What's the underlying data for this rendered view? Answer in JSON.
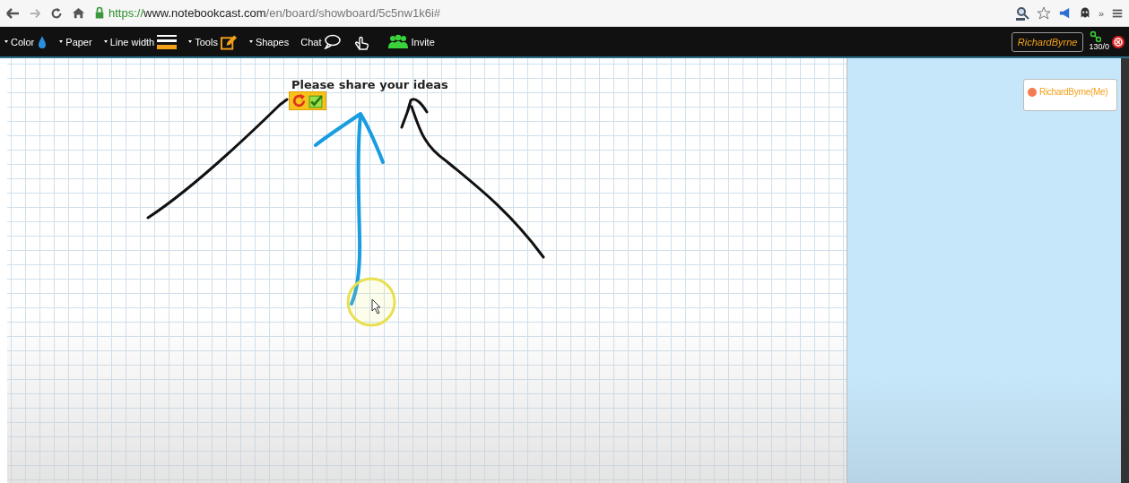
{
  "browser": {
    "url": {
      "scheme": "https://",
      "host": "www.notebookcast.com",
      "path": "/en/board/showboard/5c5nw1k6i#"
    },
    "overflow": "»"
  },
  "toolbar": {
    "items": [
      {
        "kind": "dropdown",
        "label": "Color"
      },
      {
        "kind": "dropdown",
        "label": "Paper"
      },
      {
        "kind": "dropdown",
        "label": "Line width"
      },
      {
        "kind": "dropdown",
        "label": "Tools"
      },
      {
        "kind": "dropdown",
        "label": "Shapes"
      },
      {
        "kind": "button",
        "label": "Chat"
      },
      {
        "kind": "icon"
      },
      {
        "kind": "button",
        "label": "Invite"
      }
    ],
    "user": "RichardByrne",
    "counter": "130/0"
  },
  "board": {
    "title": "Please share your ideas"
  },
  "participants": [
    {
      "name": "RichardByrne(Me)",
      "color": "#f47c50"
    }
  ]
}
